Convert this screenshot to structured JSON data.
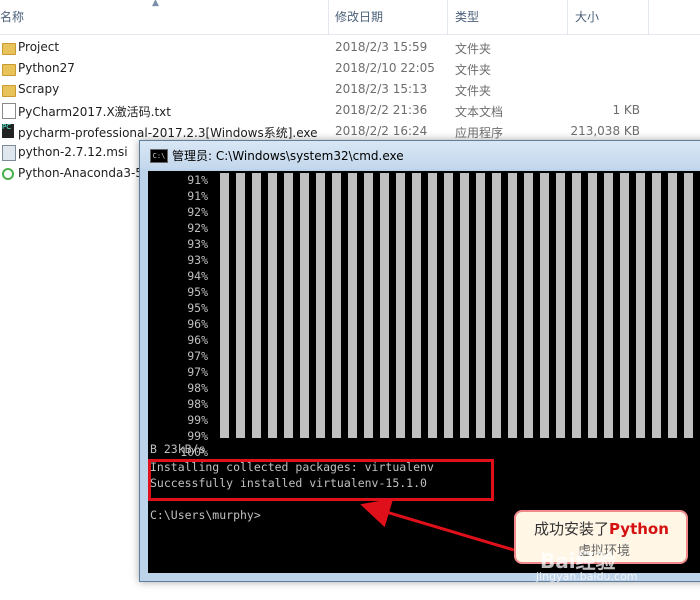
{
  "explorer": {
    "headers": {
      "name": "名称",
      "date": "修改日期",
      "type": "类型",
      "size": "大小"
    },
    "rows": [
      {
        "name": "Project",
        "date": "2018/2/3 15:59",
        "type": "文件夹",
        "size": "",
        "icon": "folder-icon"
      },
      {
        "name": "Python27",
        "date": "2018/2/10 22:05",
        "type": "文件夹",
        "size": "",
        "icon": "folder-icon"
      },
      {
        "name": "Scrapy",
        "date": "2018/2/3 15:13",
        "type": "文件夹",
        "size": "",
        "icon": "folder-icon"
      },
      {
        "name": "PyCharm2017.X激活码.txt",
        "date": "2018/2/2 21:36",
        "type": "文本文档",
        "size": "1 KB",
        "icon": "text-file-icon"
      },
      {
        "name": "pycharm-professional-2017.2.3[Windows系统].exe",
        "date": "2018/2/2 16:24",
        "type": "应用程序",
        "size": "213,038 KB",
        "icon": "pycharm-icon"
      },
      {
        "name": "python-2.7.12.msi",
        "date": "",
        "type": "",
        "size": "",
        "icon": "msi-icon"
      },
      {
        "name": "Python-Anaconda3-5",
        "date": "",
        "type": "",
        "size": "",
        "icon": "anaconda-icon"
      }
    ]
  },
  "cmd": {
    "title": "管理员: C:\\Windows\\system32\\cmd.exe",
    "icon_text": "C:\\",
    "progress_lines": [
      "91%",
      "91%",
      "92%",
      "92%",
      "93%",
      "93%",
      "94%",
      "95%",
      "95%",
      "96%",
      "96%",
      "97%",
      "97%",
      "98%",
      "98%",
      "99%",
      "99%",
      "100%"
    ],
    "speed_line": "B 23kB/s",
    "installing_line": "Installing collected packages: virtualenv",
    "success_line": "Successfully installed virtualenv-15.1.0",
    "prompt_line": "C:\\Users\\murphy>"
  },
  "callout": {
    "text_prefix": "成功安装了",
    "text_highlight": "Python",
    "text_sub": "虚拟环境"
  },
  "watermark": {
    "brand": "Bai经验",
    "url": "jingyan.baidu.com"
  },
  "colors": {
    "highlight_border": "#e0101a",
    "callout_border": "#f08a8a",
    "callout_highlight": "#d41010"
  }
}
